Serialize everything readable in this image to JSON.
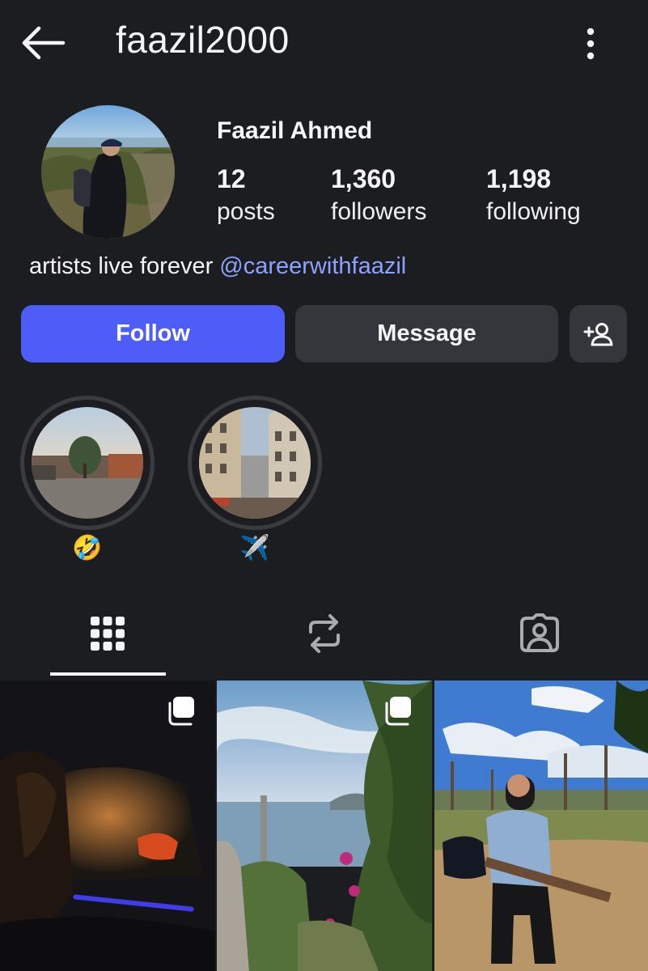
{
  "header": {
    "username": "faazil2000",
    "back_icon": "back-arrow-icon",
    "more_icon": "more-vertical-icon"
  },
  "profile": {
    "full_name": "Faazil Ahmed",
    "stats": {
      "posts": {
        "value": "12",
        "label": "posts"
      },
      "followers": {
        "value": "1,360",
        "label": "followers"
      },
      "following": {
        "value": "1,198",
        "label": "following"
      }
    },
    "bio": {
      "text": "artists live forever ",
      "link": "@careerwithfaazil"
    }
  },
  "actions": {
    "follow_label": "Follow",
    "message_label": "Message",
    "add_person_icon": "add-person-icon"
  },
  "highlights": [
    {
      "label": "🤣"
    },
    {
      "label": "✈️"
    }
  ],
  "tabs": [
    {
      "icon": "grid-icon",
      "selected": true
    },
    {
      "icon": "repost-icon",
      "selected": false
    },
    {
      "icon": "tagged-icon",
      "selected": false
    }
  ],
  "colors": {
    "background": "#1c1d21",
    "follow_button": "#4e5cf8",
    "secondary_button": "#35363c",
    "link": "#8ea2ff"
  }
}
